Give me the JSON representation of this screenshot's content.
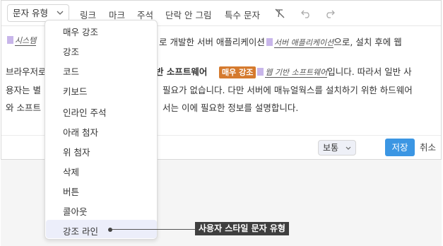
{
  "toolbar": {
    "style_select": "문자 유형",
    "link": "링크",
    "mark": "마크",
    "comment": "주석",
    "paragraph_no_image": "단락 안 그림",
    "special_char": "특수 문자"
  },
  "content": {
    "line1_a": "시스템",
    "line1_b": "로 개발한 서버 애플리케이션",
    "line1_c": "서버 애플리케이션",
    "line1_d": "으로, 설치 후에 웹",
    "line2_a": "브라우저로",
    "line2_b": "반 소프트웨어",
    "line2_chip": "매우 강조",
    "line2_c": "웹 기반 소프트웨어",
    "line2_d": "입니다. 따라서 일반 사",
    "line3_a": "용자는 별",
    "line3_b": "필요가 없습니다. 다만 서버에 매뉴얼웍스를 설치하기 위한 하드웨어",
    "line4_a": "와 소프트",
    "line4_b": "서는 이에 필요한 정보를 설명합니다."
  },
  "footer": {
    "size_select": "보통",
    "save": "저장",
    "cancel": "취소"
  },
  "dropdown": {
    "items": [
      "매우 강조",
      "강조",
      "코드",
      "키보드",
      "인라인 주석",
      "아래 첨자",
      "위 첨자",
      "삭제",
      "버튼",
      "콜아웃",
      "강조 라인"
    ]
  },
  "callout": {
    "label": "사용자 스타일 문자 유형"
  },
  "colors": {
    "accent": "#3b96e3",
    "chip": "#d57a2e",
    "marker": "#c8b6ea"
  }
}
